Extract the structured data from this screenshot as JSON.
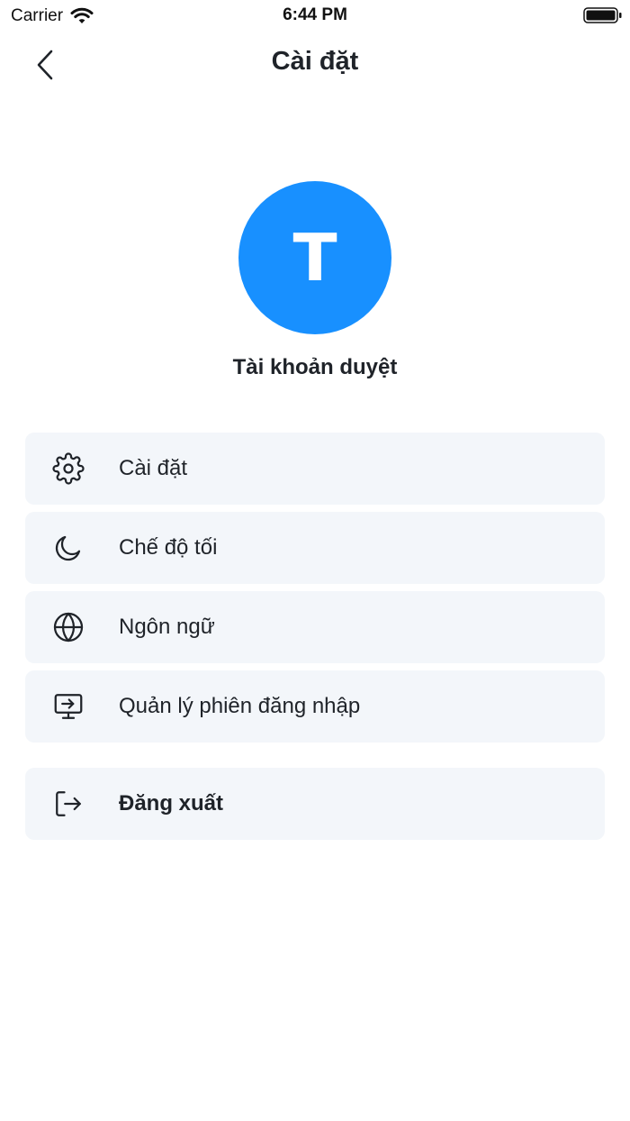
{
  "status_bar": {
    "carrier": "Carrier",
    "time": "6:44 PM"
  },
  "nav": {
    "title": "Cài đặt",
    "back_icon": "chevron-left-icon"
  },
  "profile": {
    "avatar_letter": "T",
    "avatar_color": "#1890ff",
    "name": "Tài khoản duyệt"
  },
  "menu": {
    "items": [
      {
        "label": "Cài đặt",
        "icon": "gear-icon"
      },
      {
        "label": "Chế độ tối",
        "icon": "moon-icon"
      },
      {
        "label": "Ngôn ngữ",
        "icon": "globe-icon"
      },
      {
        "label": "Quản lý phiên đăng nhập",
        "icon": "monitor-icon"
      }
    ],
    "logout": {
      "label": "Đăng xuất",
      "icon": "logout-icon"
    }
  },
  "colors": {
    "item_background": "#f3f6fa",
    "text": "#1f2329"
  }
}
